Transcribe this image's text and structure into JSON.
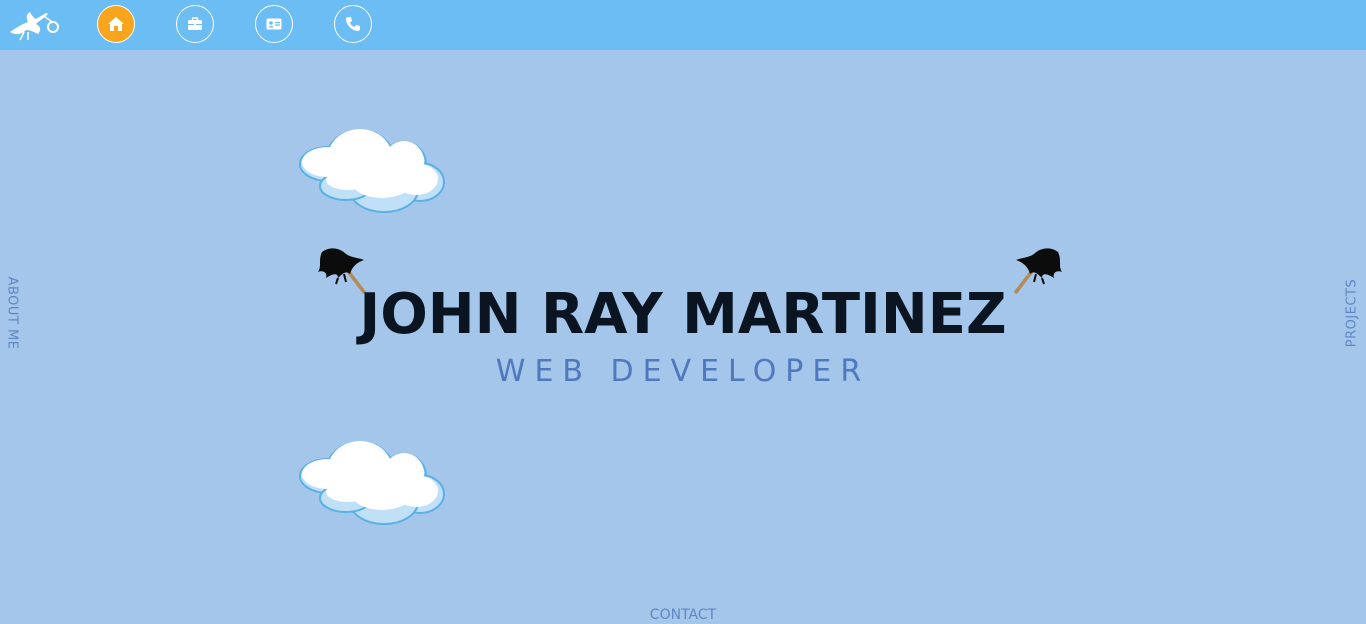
{
  "nav": {
    "logo_icon": "stork-icon",
    "buttons": [
      {
        "name": "home",
        "icon": "home-icon",
        "active": true
      },
      {
        "name": "projects",
        "icon": "briefcase-icon",
        "active": false
      },
      {
        "name": "about",
        "icon": "id-card-icon",
        "active": false
      },
      {
        "name": "contact",
        "icon": "phone-icon",
        "active": false
      }
    ],
    "active_color": "#f6a51c",
    "bar_color": "#6bbdf4"
  },
  "hero": {
    "name": "JOHN RAY MARTINEZ",
    "role": "WEB DEVELOPER"
  },
  "side_links": {
    "left": "ABOUT ME",
    "right": "PROJECTS",
    "bottom": "CONTACT"
  },
  "colors": {
    "background": "#a3c6ea",
    "name_text": "#0b1522",
    "role_text": "#4f78bd",
    "link_text": "#5f87c4"
  }
}
